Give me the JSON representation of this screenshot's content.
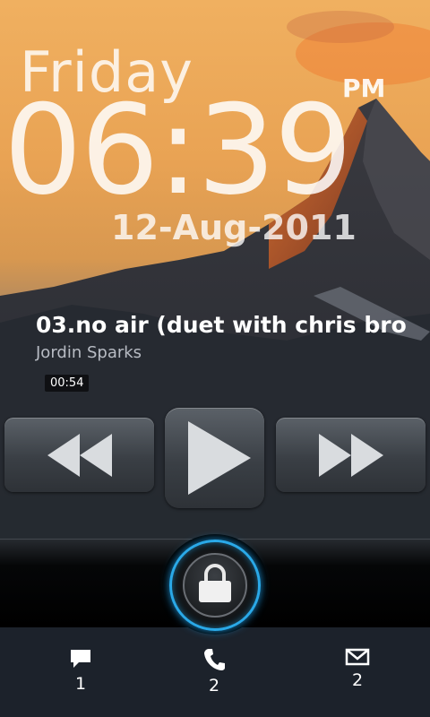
{
  "clock": {
    "day": "Friday",
    "time": "06:39",
    "ampm": "PM",
    "date": "12-Aug-2011"
  },
  "media": {
    "title": "03.no air (duet with chris bro",
    "artist": "Jordin Sparks",
    "elapsed": "00:54"
  },
  "notifications": {
    "messages_count": "1",
    "calls_count": "2",
    "email_count": "2"
  },
  "icons": [
    "rewind-icon",
    "play-icon",
    "fast-forward-icon",
    "lock-icon",
    "message-icon",
    "phone-icon",
    "email-icon"
  ],
  "colors": {
    "lock_ring": "#2aa9e8",
    "sky_orange": "#e8a25a"
  }
}
